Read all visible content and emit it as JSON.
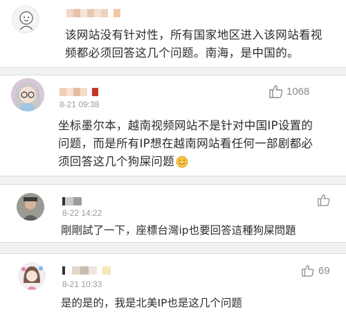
{
  "comments": [
    {
      "time": "",
      "text_lines": [
        "该网站没有针对性，所有国家地区进入该网站看视",
        "频都必须回答这几个问题。南海，是中国的。"
      ],
      "likes": ""
    },
    {
      "time": "8-21 09:38",
      "text_lines": [
        "坐标墨尔本，越南视频网站不是针对中国IP设置的",
        "问题，而是所有IP想在越南网站看任何一部剧都必",
        "须回答这几个狗屎问题"
      ],
      "likes": "1068"
    },
    {
      "time": "8-22 14:22",
      "text_lines": [
        "剛剛試了一下，座標台灣ip也要回答這種狗屎問題"
      ],
      "likes": ""
    },
    {
      "time": "8-21 10:33",
      "text_lines": [
        "是的是的，我是北美IP也是这几个问题"
      ],
      "likes": "69"
    }
  ],
  "colors": {
    "background": "#ffffff",
    "divider": "#f2f2f2",
    "time": "#9a9a9a",
    "text": "#2b2b2b",
    "name_mosaic_red": "#c0392b"
  },
  "icons": {
    "like": "thumbs-up-icon",
    "emoji": "grin-emoji-icon"
  }
}
